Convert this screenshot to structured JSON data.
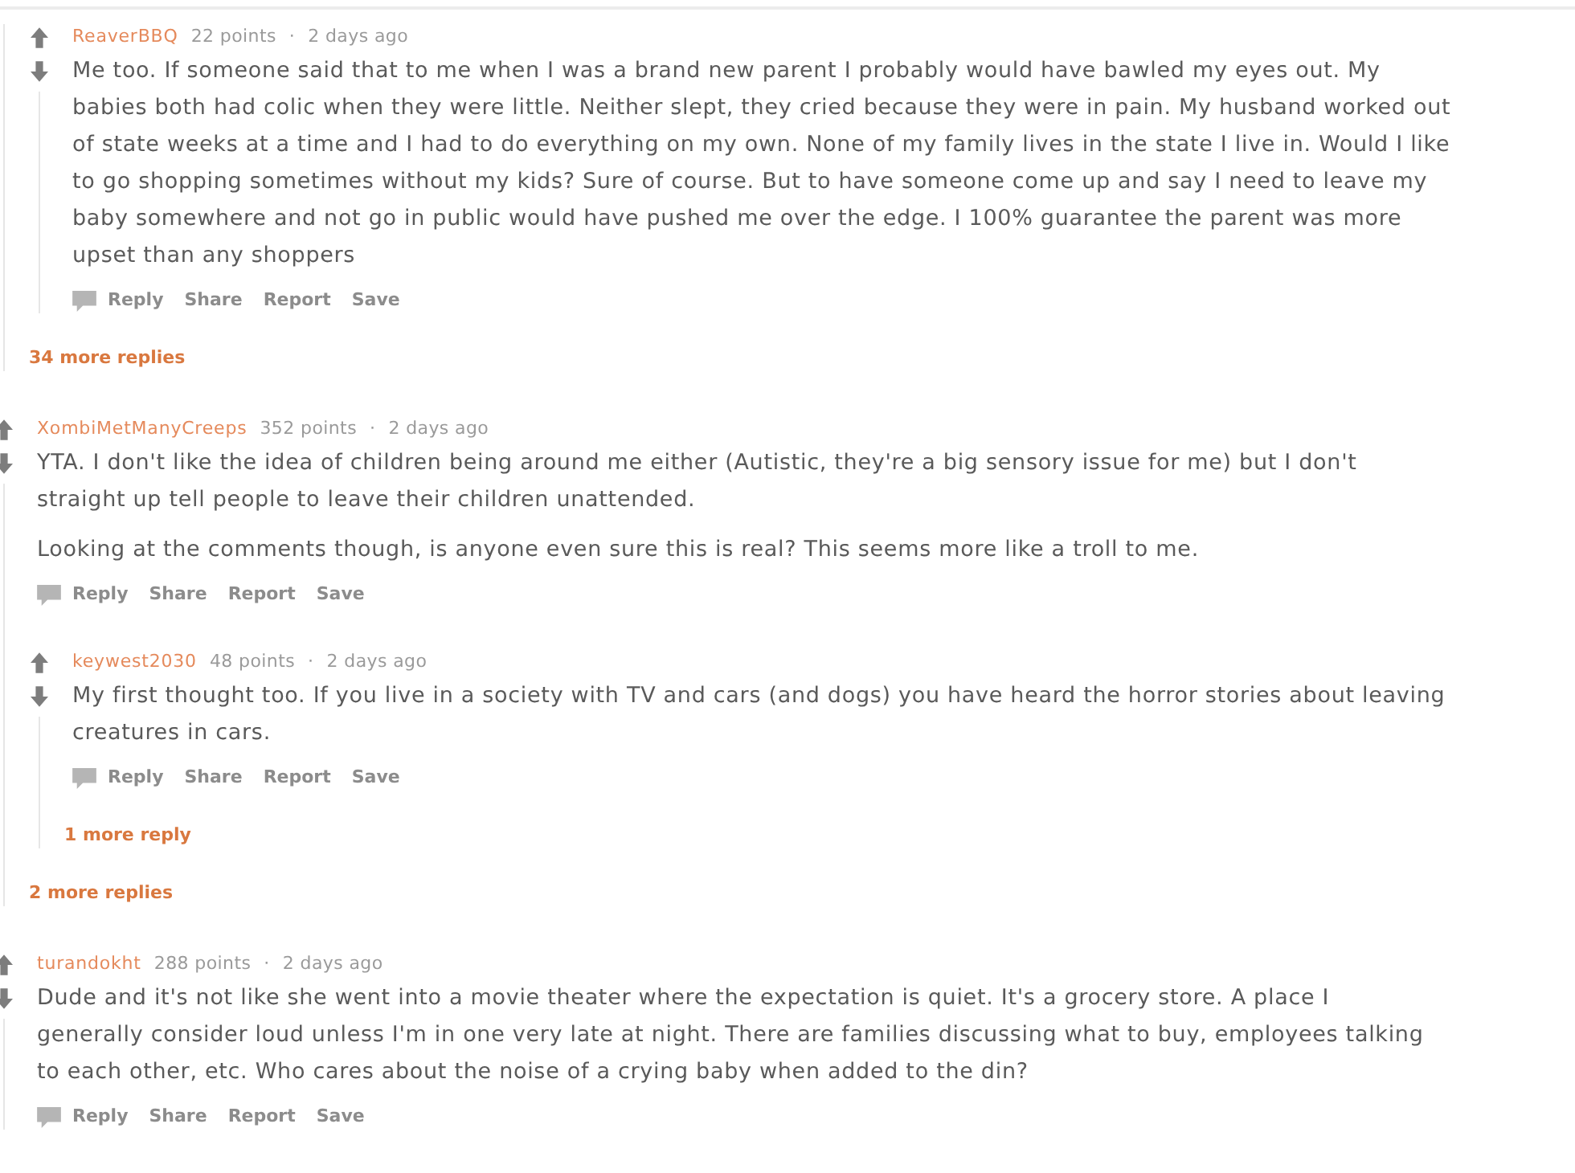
{
  "threads": [
    {
      "kind": "continued",
      "children": [
        {
          "kind": "comment",
          "author": "ReaverBBQ",
          "points": "22 points",
          "separator": "·",
          "time": "2 days ago",
          "paragraphs": [
            "Me too. If someone said that to me when I was a brand new parent I probably would have bawled my eyes out. My babies both had colic when they were little. Neither slept, they cried because they were in pain. My husband worked out of state weeks at a time and I had to do everything on my own. None of my family lives in the state I live in. Would I like to go shopping sometimes without my kids? Sure of course. But to have someone come up and say I need to leave my baby somewhere and not go in public would have pushed me over the edge. I 100% guarantee the parent was more upset than any shoppers"
          ],
          "actions": [
            "Reply",
            "Share",
            "Report",
            "Save"
          ]
        }
      ],
      "more_replies": "34 more replies"
    },
    {
      "kind": "comment",
      "author": "XombiMetManyCreeps",
      "points": "352 points",
      "separator": "·",
      "time": "2 days ago",
      "paragraphs": [
        "YTA. I don't like the idea of children being around me either (Autistic, they're a big sensory issue for me) but I don't straight up tell people to leave their children unattended.",
        "Looking at the comments though, is anyone even sure this is real? This seems more like a troll to me."
      ],
      "actions": [
        "Reply",
        "Share",
        "Report",
        "Save"
      ],
      "children": [
        {
          "kind": "comment",
          "author": "keywest2030",
          "points": "48 points",
          "separator": "·",
          "time": "2 days ago",
          "paragraphs": [
            "My first thought too. If you live in a society with TV and cars (and dogs) you have heard the horror stories about leaving creatures in cars."
          ],
          "actions": [
            "Reply",
            "Share",
            "Report",
            "Save"
          ],
          "more_replies": "1 more reply"
        }
      ],
      "more_replies": "2 more replies"
    },
    {
      "kind": "comment",
      "author": "turandokht",
      "points": "288 points",
      "separator": "·",
      "time": "2 days ago",
      "paragraphs": [
        "Dude and it's not like she went into a movie theater where the expectation is quiet. It's a grocery store. A place I generally consider loud unless I'm in one very late at night. There are families discussing what to buy, employees talking to each other, etc. Who cares about the noise of a crying baby when added to the din?"
      ],
      "actions": [
        "Reply",
        "Share",
        "Report",
        "Save"
      ]
    }
  ]
}
